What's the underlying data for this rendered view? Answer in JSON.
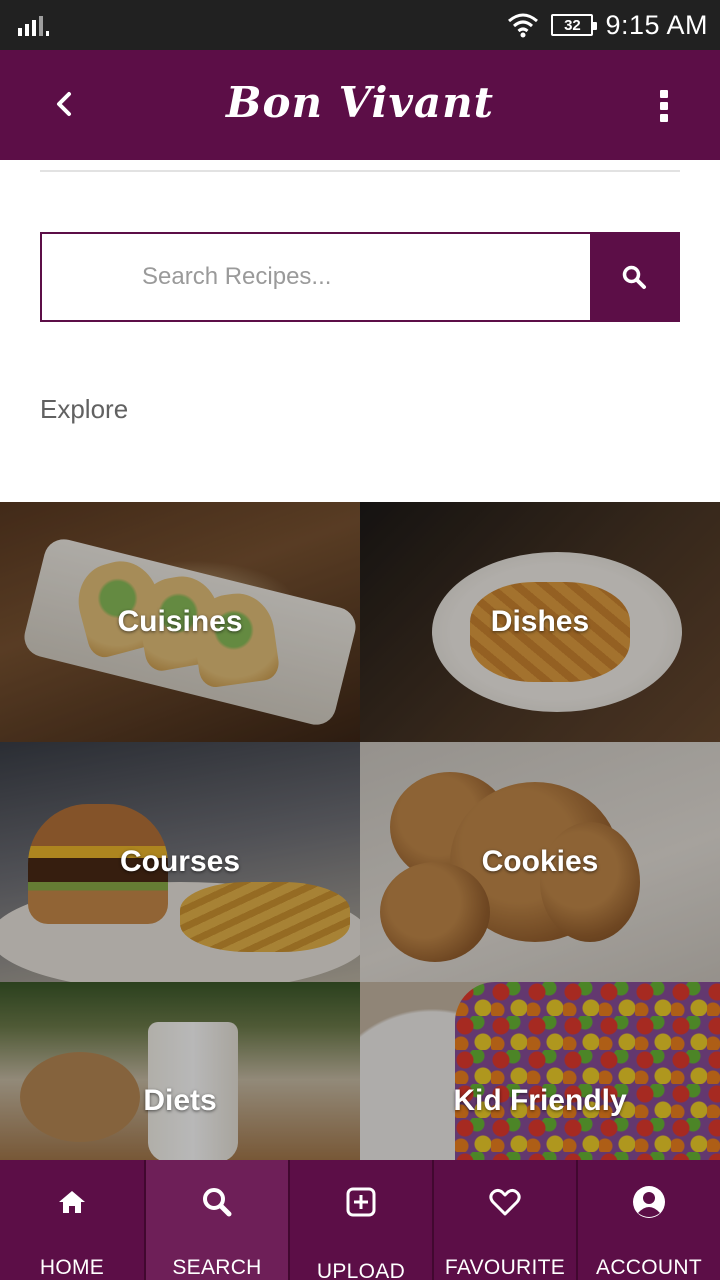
{
  "status_bar": {
    "battery": "32",
    "time": "9:15 AM",
    "icons": [
      "signal-icon",
      "wifi-icon",
      "battery-icon"
    ]
  },
  "app_bar": {
    "title": "Bon Vivant",
    "back_icon": "chevron-left-icon",
    "menu_icon": "more-vertical-icon"
  },
  "search": {
    "placeholder": "Search Recipes...",
    "value": "",
    "button_icon": "search-icon"
  },
  "explore": {
    "heading": "Explore",
    "categories": [
      {
        "label": "Cuisines"
      },
      {
        "label": "Dishes"
      },
      {
        "label": "Courses"
      },
      {
        "label": "Cookies"
      },
      {
        "label": "Diets"
      },
      {
        "label": "Kid Friendly"
      }
    ]
  },
  "bottom_nav": {
    "active": "SEARCH",
    "items": [
      {
        "label": "HOME",
        "icon": "home-icon"
      },
      {
        "label": "SEARCH",
        "icon": "search-icon"
      },
      {
        "label": "UPLOAD",
        "icon": "plus-square-icon"
      },
      {
        "label": "FAVOURITE",
        "icon": "heart-icon"
      },
      {
        "label": "ACCOUNT",
        "icon": "account-circle-icon"
      }
    ]
  },
  "colors": {
    "primary": "#5c0e47",
    "nav_active": "#6e1f58",
    "status_bar": "#212121",
    "text_muted": "#616161"
  }
}
